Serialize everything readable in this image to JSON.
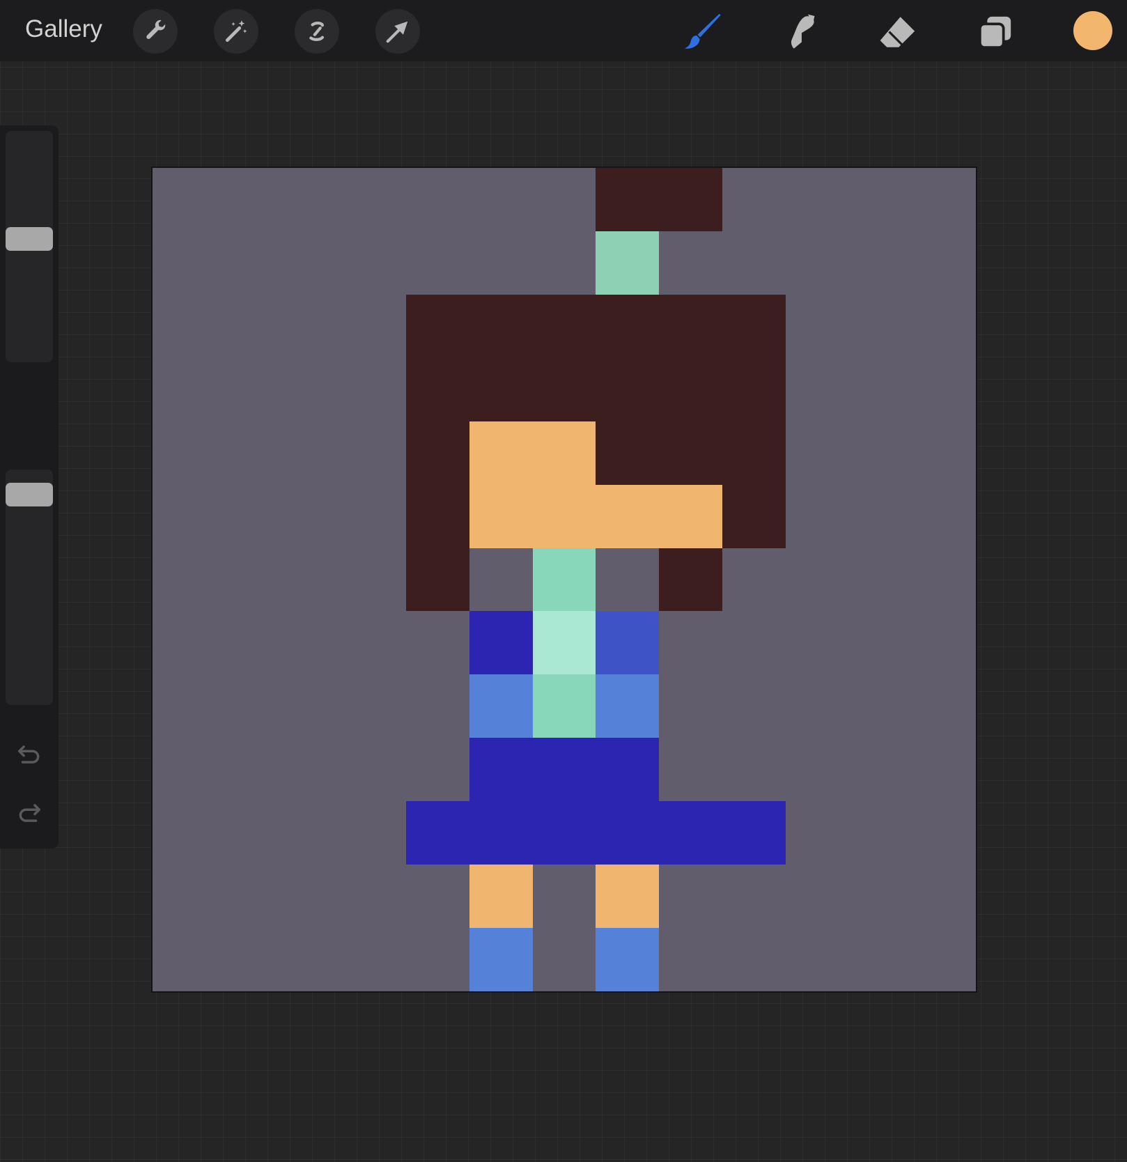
{
  "topbar": {
    "gallery_label": "Gallery",
    "left_tools": [
      {
        "name": "actions-wrench-icon"
      },
      {
        "name": "adjustments-magic-wand-icon"
      },
      {
        "name": "selection-icon"
      },
      {
        "name": "transform-arrow-icon"
      }
    ],
    "right_tools": [
      {
        "name": "brush-icon",
        "active": true
      },
      {
        "name": "smudge-icon",
        "active": false
      },
      {
        "name": "eraser-icon",
        "active": false
      },
      {
        "name": "layers-icon",
        "active": false
      }
    ],
    "current_color": "#F2B66E"
  },
  "sidebar": {
    "brush_size_slider": "brush-size",
    "opacity_slider": "opacity",
    "modify_button": "modify-square-icon",
    "undo_icon": "undo-arrow-icon",
    "redo_icon": "redo-arrow-icon"
  },
  "colors": {
    "accent": "#2F6FE4",
    "background": "#615D6C",
    "hair": "#3C1E1F",
    "skin": "#F0B56E",
    "mint": "#8DD0B4",
    "mint_mid": "#88D7BB",
    "mint_light": "#AAE8D4",
    "navy": "#2B25B2",
    "royal": "#3D53C6",
    "sky": "#5681D9"
  },
  "pixel_art": {
    "grid_width": 13,
    "grid_height": 13,
    "palette": {
      "0": "#615D6C",
      "1": "#3C1E1F",
      "2": "#F0B56E",
      "3": "#8DD0B4",
      "4": "#88D7BB",
      "5": "#AAE8D4",
      "6": "#2B25B2",
      "7": "#3D53C6",
      "8": "#5681D9"
    },
    "rows": [
      "0000000110000",
      "0000000300000",
      "0000111111000",
      "0000111111000",
      "0000122111000",
      "0000122221000",
      "0000104010000",
      "0000065700000",
      "0000084800000",
      "0000066600000",
      "0000666666000",
      "0000020200000",
      "0000080800000"
    ]
  }
}
